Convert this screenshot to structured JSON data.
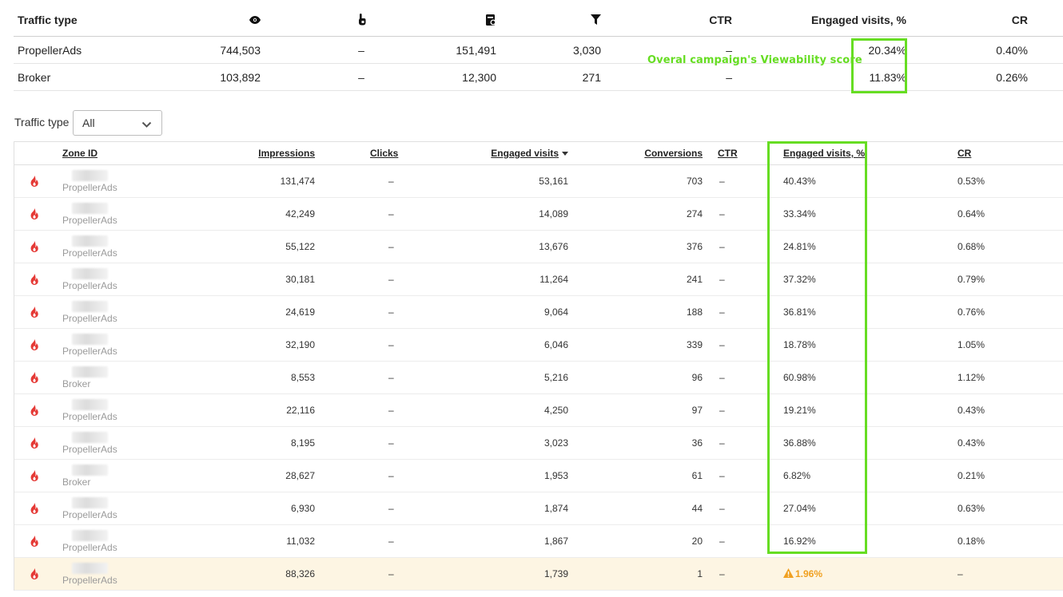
{
  "summary": {
    "headers": {
      "traffic_type": "Traffic type",
      "impressions_icon": "eye-icon",
      "clicks_icon": "click-hand-icon",
      "engaged_icon": "landing-page-icon",
      "conversions_icon": "funnel-icon",
      "ctr": "CTR",
      "engaged_pct": "Engaged visits, %",
      "cr": "CR"
    },
    "rows": [
      {
        "traffic_type": "PropellerAds",
        "impressions": "744,503",
        "clicks": "–",
        "engaged": "151,491",
        "conversions": "3,030",
        "ctr": "–",
        "engaged_pct": "20.34%",
        "cr": "0.40%"
      },
      {
        "traffic_type": "Broker",
        "impressions": "103,892",
        "clicks": "–",
        "engaged": "12,300",
        "conversions": "271",
        "ctr": "–",
        "engaged_pct": "11.83%",
        "cr": "0.26%"
      }
    ],
    "annotation": "Overal campaign's Viewability score",
    "highlight_color": "#66dd22"
  },
  "filter": {
    "label": "Traffic type",
    "value": "All"
  },
  "zones": {
    "headers": {
      "zone_id": "Zone ID",
      "impressions": "Impressions",
      "clicks": "Clicks",
      "engaged": "Engaged visits",
      "conversions": "Conversions",
      "ctr": "CTR",
      "engaged_pct": "Engaged visits, %",
      "cr": "CR"
    },
    "rows": [
      {
        "source": "PropellerAds",
        "impressions": "131,474",
        "clicks": "–",
        "engaged": "53,161",
        "conversions": "703",
        "ctr": "–",
        "engaged_pct": "40.43%",
        "cr": "0.53%"
      },
      {
        "source": "PropellerAds",
        "impressions": "42,249",
        "clicks": "–",
        "engaged": "14,089",
        "conversions": "274",
        "ctr": "–",
        "engaged_pct": "33.34%",
        "cr": "0.64%"
      },
      {
        "source": "PropellerAds",
        "impressions": "55,122",
        "clicks": "–",
        "engaged": "13,676",
        "conversions": "376",
        "ctr": "–",
        "engaged_pct": "24.81%",
        "cr": "0.68%"
      },
      {
        "source": "PropellerAds",
        "impressions": "30,181",
        "clicks": "–",
        "engaged": "11,264",
        "conversions": "241",
        "ctr": "–",
        "engaged_pct": "37.32%",
        "cr": "0.79%"
      },
      {
        "source": "PropellerAds",
        "impressions": "24,619",
        "clicks": "–",
        "engaged": "9,064",
        "conversions": "188",
        "ctr": "–",
        "engaged_pct": "36.81%",
        "cr": "0.76%"
      },
      {
        "source": "PropellerAds",
        "impressions": "32,190",
        "clicks": "–",
        "engaged": "6,046",
        "conversions": "339",
        "ctr": "–",
        "engaged_pct": "18.78%",
        "cr": "1.05%"
      },
      {
        "source": "Broker",
        "impressions": "8,553",
        "clicks": "–",
        "engaged": "5,216",
        "conversions": "96",
        "ctr": "–",
        "engaged_pct": "60.98%",
        "cr": "1.12%"
      },
      {
        "source": "PropellerAds",
        "impressions": "22,116",
        "clicks": "–",
        "engaged": "4,250",
        "conversions": "97",
        "ctr": "–",
        "engaged_pct": "19.21%",
        "cr": "0.43%"
      },
      {
        "source": "PropellerAds",
        "impressions": "8,195",
        "clicks": "–",
        "engaged": "3,023",
        "conversions": "36",
        "ctr": "–",
        "engaged_pct": "36.88%",
        "cr": "0.43%"
      },
      {
        "source": "Broker",
        "impressions": "28,627",
        "clicks": "–",
        "engaged": "1,953",
        "conversions": "61",
        "ctr": "–",
        "engaged_pct": "6.82%",
        "cr": "0.21%"
      },
      {
        "source": "PropellerAds",
        "impressions": "6,930",
        "clicks": "–",
        "engaged": "1,874",
        "conversions": "44",
        "ctr": "–",
        "engaged_pct": "27.04%",
        "cr": "0.63%"
      },
      {
        "source": "PropellerAds",
        "impressions": "11,032",
        "clicks": "–",
        "engaged": "1,867",
        "conversions": "20",
        "ctr": "–",
        "engaged_pct": "16.92%",
        "cr": "0.18%"
      },
      {
        "source": "PropellerAds",
        "impressions": "88,326",
        "clicks": "–",
        "engaged": "1,739",
        "conversions": "1",
        "ctr": "–",
        "engaged_pct": "1.96%",
        "cr": "–",
        "warning": true
      }
    ],
    "fire_icon": "fire-icon",
    "fire_color": "#e53935",
    "warning_icon": "warning-triangle-icon",
    "warning_color": "#f0a020",
    "warning_row_bg": "#fdf5e3"
  }
}
